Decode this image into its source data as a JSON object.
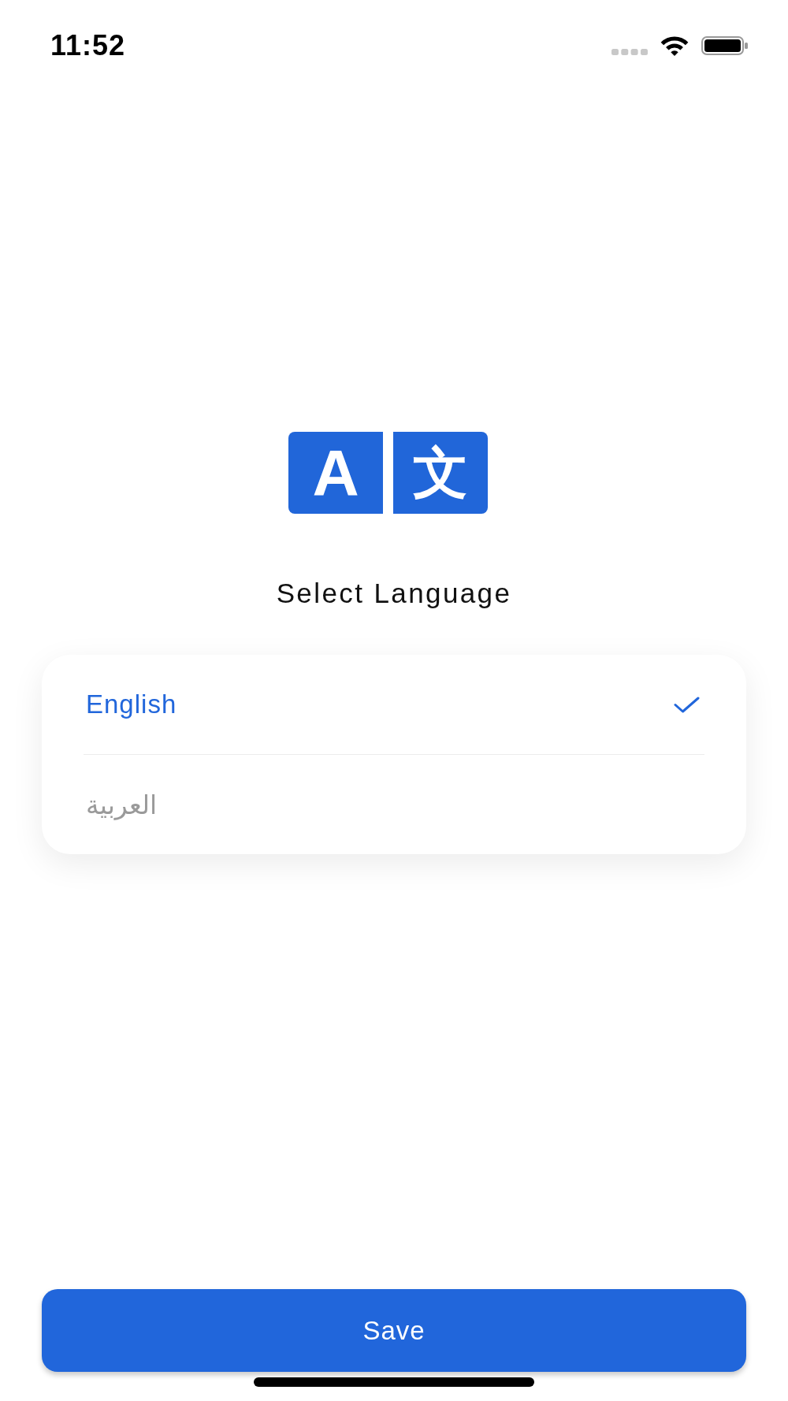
{
  "status_bar": {
    "time": "11:52"
  },
  "logo": {
    "tiles": [
      "A",
      "文"
    ]
  },
  "header": {
    "title": "Select Language"
  },
  "languages": [
    {
      "label": "English",
      "selected": true
    },
    {
      "label": "العربية",
      "selected": false
    }
  ],
  "save_button": {
    "label": "Save"
  }
}
